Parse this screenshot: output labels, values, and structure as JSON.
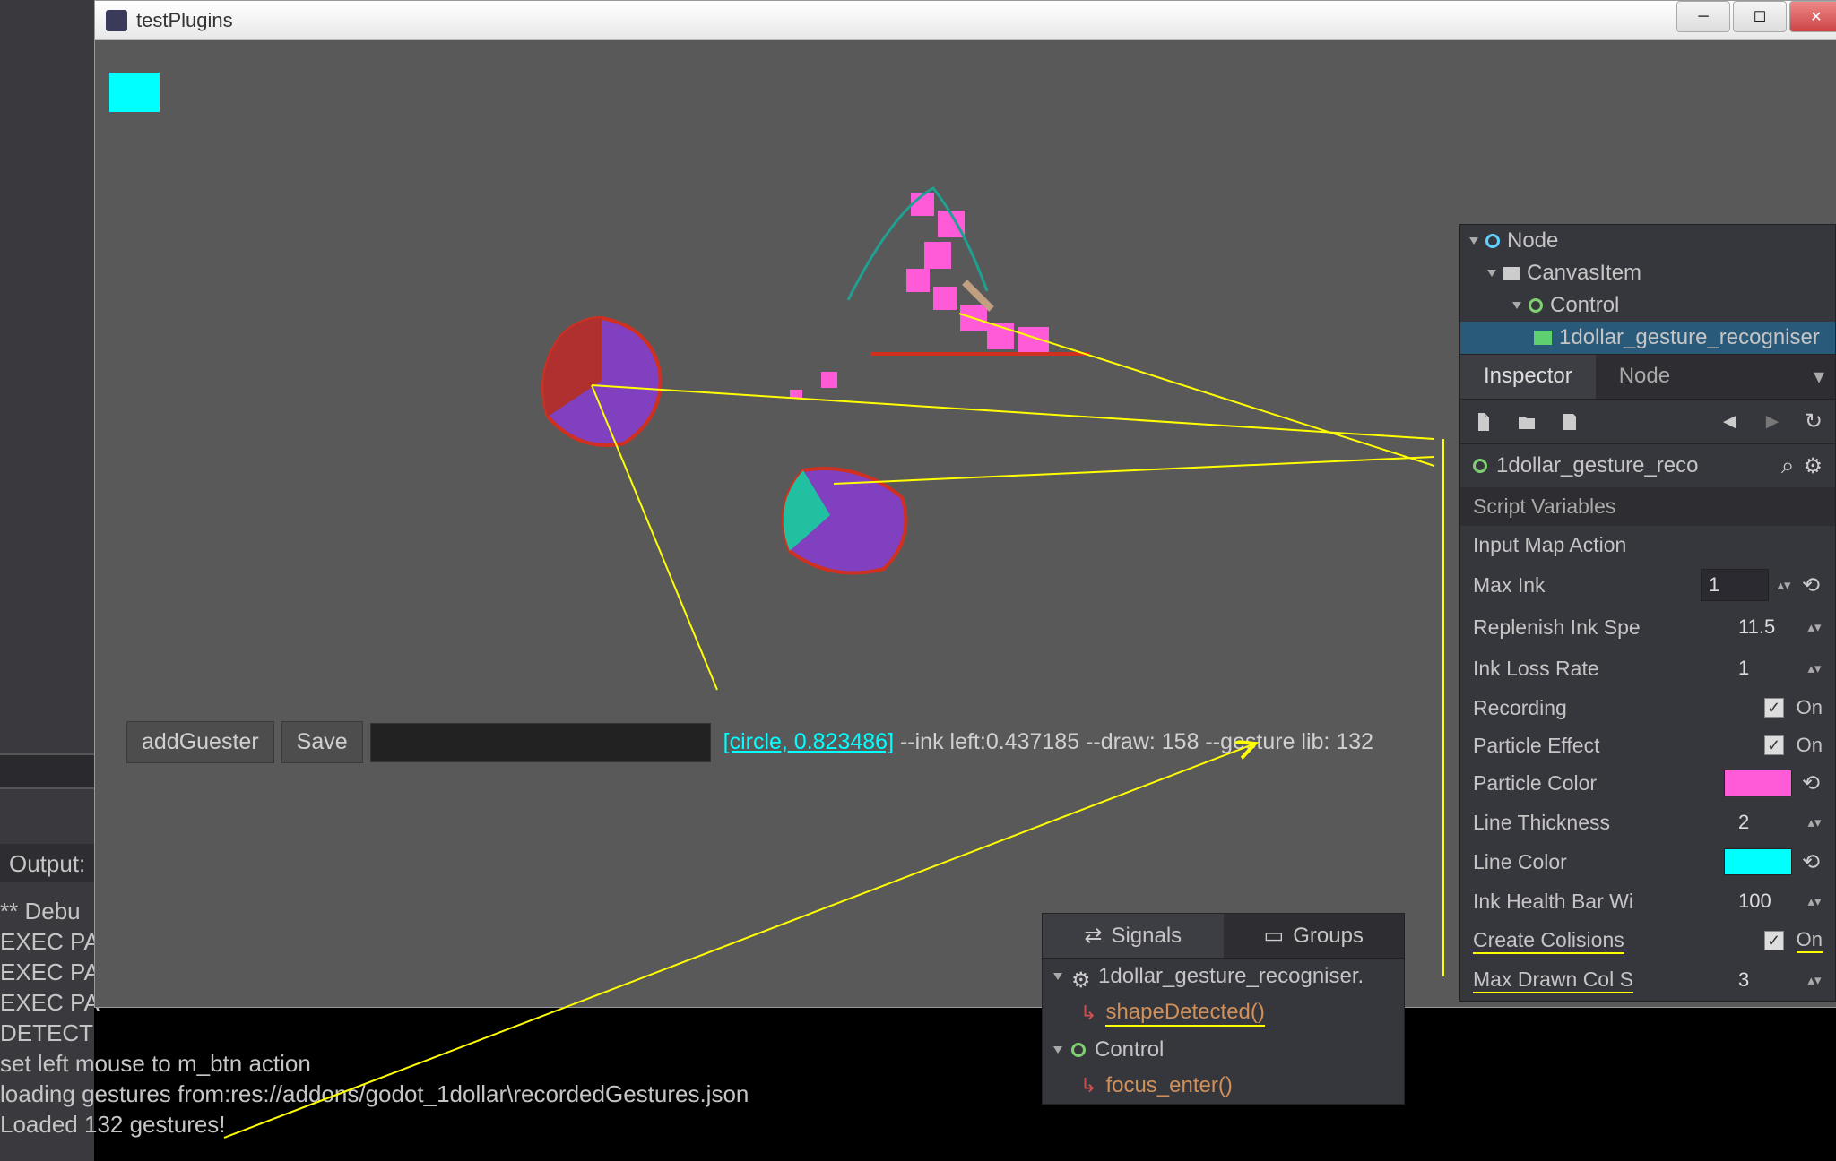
{
  "window": {
    "title": "testPlugins"
  },
  "output": {
    "header": "Output:",
    "lines": [
      "** Debu",
      "EXEC PA",
      "EXEC PA",
      "EXEC PA",
      "DETECT",
      "set left mouse to m_btn action",
      "loading gestures from:res://addons/godot_1dollar\\recordedGestures.json",
      "Loaded 132 gestures!"
    ]
  },
  "hud": {
    "add_btn": "addGuester",
    "save_btn": "Save",
    "result": "[circle, 0.823486]",
    "rest": " --ink left:0.437185 --draw: 158 --gesture lib: 132"
  },
  "tree": {
    "node": "Node",
    "canvas": "CanvasItem",
    "control": "Control",
    "recogniser": "1dollar_gesture_recogniser"
  },
  "tabs": {
    "inspector": "Inspector",
    "node": "Node"
  },
  "inspector": {
    "node_name": "1dollar_gesture_reco",
    "section": "Script Variables",
    "props": {
      "input_map": {
        "label": "Input Map Action",
        "value": ""
      },
      "max_ink": {
        "label": "Max Ink",
        "value": "1"
      },
      "replenish": {
        "label": "Replenish Ink Spe",
        "value": "11.5"
      },
      "loss": {
        "label": "Ink Loss Rate",
        "value": "1"
      },
      "recording": {
        "label": "Recording",
        "checked": "On"
      },
      "particle_effect": {
        "label": "Particle Effect",
        "checked": "On"
      },
      "particle_color": {
        "label": "Particle Color",
        "value": "#ff5ad8"
      },
      "line_thickness": {
        "label": "Line Thickness",
        "value": "2"
      },
      "line_color": {
        "label": "Line Color",
        "value": "#00ffff"
      },
      "health_bar": {
        "label": "Ink Health Bar Wi",
        "value": "100"
      },
      "collisions": {
        "label": "Create Colisions",
        "checked": "On"
      },
      "max_drawn": {
        "label": "Max Drawn Col S",
        "value": "3"
      }
    }
  },
  "signals": {
    "tab_signals": "Signals",
    "tab_groups": "Groups",
    "node1": "1dollar_gesture_recogniser.",
    "method1": "shapeDetected()",
    "node2": "Control",
    "method2": "focus_enter()"
  }
}
